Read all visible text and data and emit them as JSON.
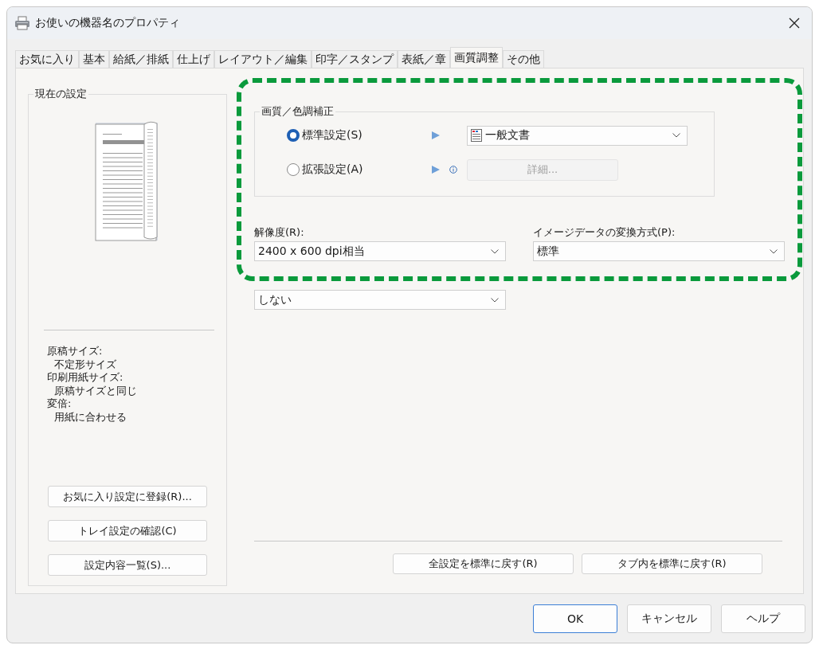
{
  "window": {
    "title": "お使いの機器名のプロパティ"
  },
  "tabs": [
    {
      "label": "お気に入り",
      "selected": false
    },
    {
      "label": "基本",
      "selected": false
    },
    {
      "label": "給紙／排紙",
      "selected": false
    },
    {
      "label": "仕上げ",
      "selected": false
    },
    {
      "label": "レイアウト／編集",
      "selected": false
    },
    {
      "label": "印字／スタンプ",
      "selected": false
    },
    {
      "label": "表紙／章",
      "selected": false
    },
    {
      "label": "画質調整",
      "selected": true
    },
    {
      "label": "その他",
      "selected": false
    }
  ],
  "current_settings": {
    "title": "現在の設定",
    "summary": [
      {
        "label": "原稿サイズ:",
        "value": "不定形サイズ"
      },
      {
        "label": "印刷用紙サイズ:",
        "value": "原稿サイズと同じ"
      },
      {
        "label": "変倍:",
        "value": "用紙に合わせる"
      }
    ],
    "buttons": [
      "お気に入り設定に登録(R)...",
      "トレイ設定の確認(C)",
      "設定内容一覧(S)..."
    ]
  },
  "color_correction": {
    "title": "画質／色調補正",
    "options": [
      {
        "label": "標準設定(S)",
        "selected": true,
        "kind": "dropdown",
        "value": "一般文書"
      },
      {
        "label": "拡張設定(A)",
        "selected": false,
        "kind": "button",
        "button": "詳細...",
        "disabled": true
      }
    ]
  },
  "fields": [
    {
      "label": "解像度(R):",
      "value": "2400 x 600 dpi相当"
    },
    {
      "label": "イメージデータの変換方式(P):",
      "value": "標準"
    }
  ],
  "extra_field": {
    "value": "しない"
  },
  "reset_buttons": [
    "全設定を標準に戻す(R)",
    "タブ内を標準に戻す(R)"
  ],
  "dialog_buttons": [
    {
      "label": "OK",
      "default": true
    },
    {
      "label": "キャンセル",
      "default": false
    },
    {
      "label": "ヘルプ",
      "default": false
    }
  ]
}
